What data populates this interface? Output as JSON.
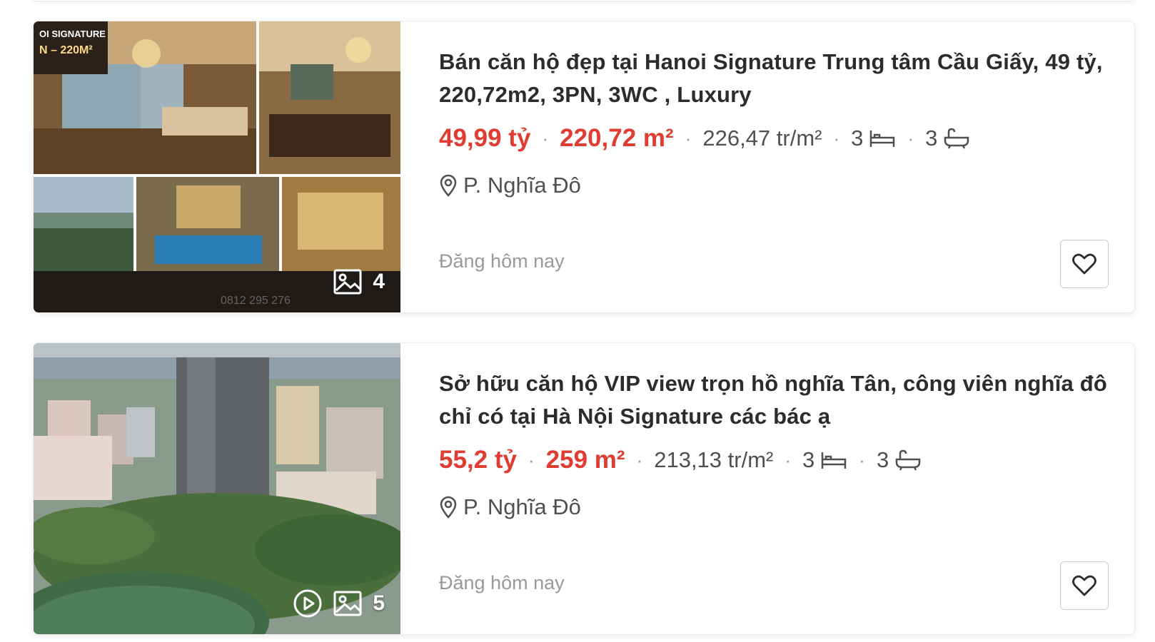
{
  "listings": [
    {
      "title": "Bán căn hộ đẹp tại Hanoi Signature Trung tâm Cầu Giấy, 49 tỷ, 220,72m2, 3PN, 3WC , Luxury",
      "price": "49,99 tỷ",
      "area": "220,72 m²",
      "price_per_m2": "226,47 tr/m²",
      "bedrooms": "3",
      "bathrooms": "3",
      "location": "P. Nghĩa Đô",
      "posted": "Đăng hôm nay",
      "photo_count": "4",
      "has_video": false
    },
    {
      "title": "Sở hữu căn hộ VIP view trọn hồ nghĩa Tân, công viên nghĩa đô chỉ có tại Hà Nội Signature các bác ạ",
      "price": "55,2 tỷ",
      "area": "259 m²",
      "price_per_m2": "213,13 tr/m²",
      "bedrooms": "3",
      "bathrooms": "3",
      "location": "P. Nghĩa Đô",
      "posted": "Đăng hôm nay",
      "photo_count": "5",
      "has_video": true
    }
  ],
  "thumbnail_text": {
    "banner_line1": "OI SIGNATURE",
    "banner_line2": "N – 220M²",
    "phone": "0812 295 276"
  },
  "colors": {
    "price": "#e03c31",
    "text": "#2c2c2c",
    "muted": "#999999"
  },
  "icons": [
    "image-gallery-icon",
    "video-play-icon",
    "bed-icon",
    "bath-icon",
    "location-pin-icon",
    "heart-icon"
  ]
}
